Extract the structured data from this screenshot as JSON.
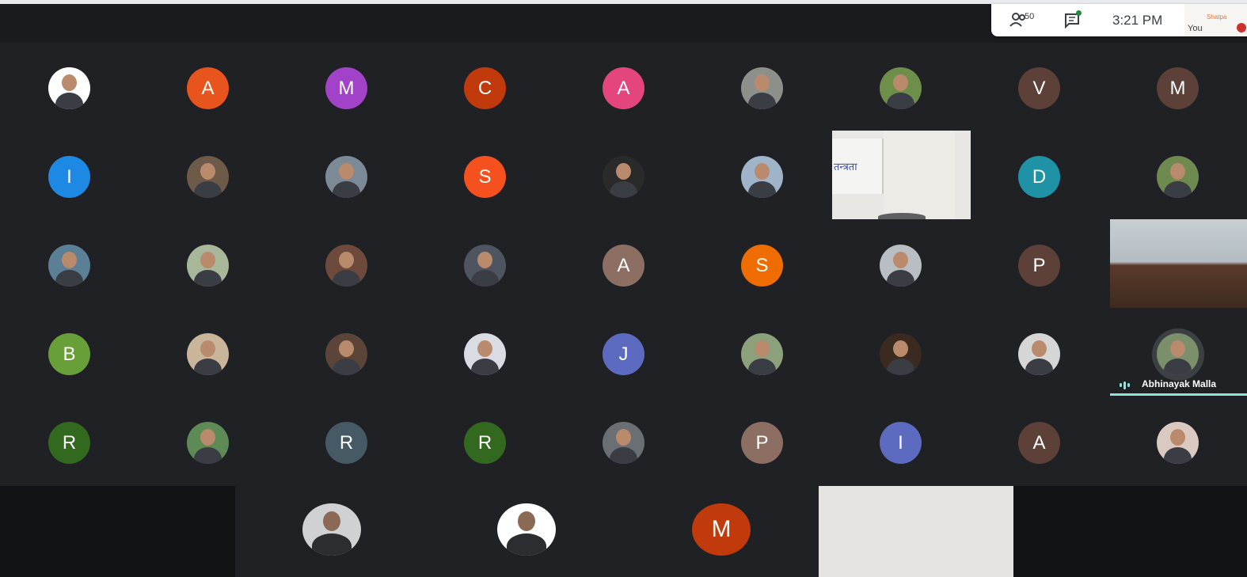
{
  "top_panel": {
    "participant_count": "50",
    "time": "3:21 PM",
    "self_label": "You",
    "self_preview_text": "Shatpa",
    "icons": {
      "people": "people-icon",
      "chat": "chat-icon"
    }
  },
  "grid": {
    "rows": [
      [
        {
          "type": "photo",
          "name": "participant-photo",
          "color": "#ffffff"
        },
        {
          "type": "initial",
          "initial": "A",
          "color": "#e8541d"
        },
        {
          "type": "initial",
          "initial": "M",
          "color": "#a142c9"
        },
        {
          "type": "initial",
          "initial": "C",
          "color": "#c13a0c"
        },
        {
          "type": "initial",
          "initial": "A",
          "color": "#e4457c"
        },
        {
          "type": "photo",
          "name": "participant-photo",
          "color": "#8d8f8a"
        },
        {
          "type": "photo",
          "name": "participant-photo",
          "color": "#6d8f4a"
        },
        {
          "type": "initial",
          "initial": "V",
          "color": "#5d4037"
        },
        {
          "type": "initial",
          "initial": "M",
          "color": "#5d4037"
        }
      ],
      [
        {
          "type": "initial",
          "initial": "I",
          "color": "#1e88e5"
        },
        {
          "type": "photo",
          "name": "participant-photo",
          "color": "#6e5a48"
        },
        {
          "type": "photo",
          "name": "participant-photo",
          "color": "#7b8a96"
        },
        {
          "type": "initial",
          "initial": "S",
          "color": "#f4511e"
        },
        {
          "type": "photo",
          "name": "participant-photo",
          "color": "#2a2a2a"
        },
        {
          "type": "photo",
          "name": "participant-photo",
          "color": "#9fb4c9"
        },
        {
          "type": "video",
          "name": "video-feed"
        },
        {
          "type": "initial",
          "initial": "D",
          "color": "#1f93a5"
        },
        {
          "type": "photo",
          "name": "participant-photo",
          "color": "#6f8a4f"
        }
      ],
      [
        {
          "type": "photo",
          "name": "participant-photo",
          "color": "#5b7f95"
        },
        {
          "type": "photo",
          "name": "participant-photo",
          "color": "#a8b79a"
        },
        {
          "type": "photo",
          "name": "participant-photo",
          "color": "#6d4a3c"
        },
        {
          "type": "photo",
          "name": "participant-photo",
          "color": "#4f5560"
        },
        {
          "type": "initial",
          "initial": "A",
          "color": "#8d6e63"
        },
        {
          "type": "initial",
          "initial": "S",
          "color": "#ef6c00"
        },
        {
          "type": "photo",
          "name": "participant-photo",
          "color": "#b9bec2"
        },
        {
          "type": "initial",
          "initial": "P",
          "color": "#5d4037"
        },
        {
          "type": "video",
          "name": "video-feed"
        }
      ],
      [
        {
          "type": "initial",
          "initial": "B",
          "color": "#689f38"
        },
        {
          "type": "photo",
          "name": "participant-photo",
          "color": "#c9b59a"
        },
        {
          "type": "photo",
          "name": "participant-photo",
          "color": "#5a4538"
        },
        {
          "type": "photo",
          "name": "participant-photo",
          "color": "#d9dde3"
        },
        {
          "type": "initial",
          "initial": "J",
          "color": "#5c6bc0"
        },
        {
          "type": "photo",
          "name": "participant-photo",
          "color": "#8ca07b"
        },
        {
          "type": "photo",
          "name": "participant-photo",
          "color": "#3b2a20"
        },
        {
          "type": "photo",
          "name": "participant-photo",
          "color": "#d6d6d6"
        },
        {
          "type": "active",
          "name": "Abhinayak Malla",
          "color": "#7a8f6a"
        }
      ],
      [
        {
          "type": "initial",
          "initial": "R",
          "color": "#33691e"
        },
        {
          "type": "photo",
          "name": "participant-photo",
          "color": "#5e8a55"
        },
        {
          "type": "initial",
          "initial": "R",
          "color": "#455a64"
        },
        {
          "type": "initial",
          "initial": "R",
          "color": "#33691e"
        },
        {
          "type": "photo",
          "name": "participant-photo",
          "color": "#6a6f73"
        },
        {
          "type": "initial",
          "initial": "P",
          "color": "#8d6e63"
        },
        {
          "type": "initial",
          "initial": "I",
          "color": "#5c6bc0"
        },
        {
          "type": "initial",
          "initial": "A",
          "color": "#5d4037"
        },
        {
          "type": "photo",
          "name": "participant-photo",
          "color": "#d9c9c0"
        }
      ]
    ]
  },
  "video_overlay_text": "तन्त्रता",
  "active_speaker": {
    "name": "Abhinayak Malla"
  },
  "bottom_row": {
    "tiles": [
      {
        "type": "photo",
        "color": "#cfd1d3"
      },
      {
        "type": "photo",
        "color": "#ffffff"
      },
      {
        "type": "initial",
        "initial": "M",
        "color": "#c13a0c"
      },
      {
        "type": "video",
        "color": "#e5e4e0"
      }
    ]
  }
}
